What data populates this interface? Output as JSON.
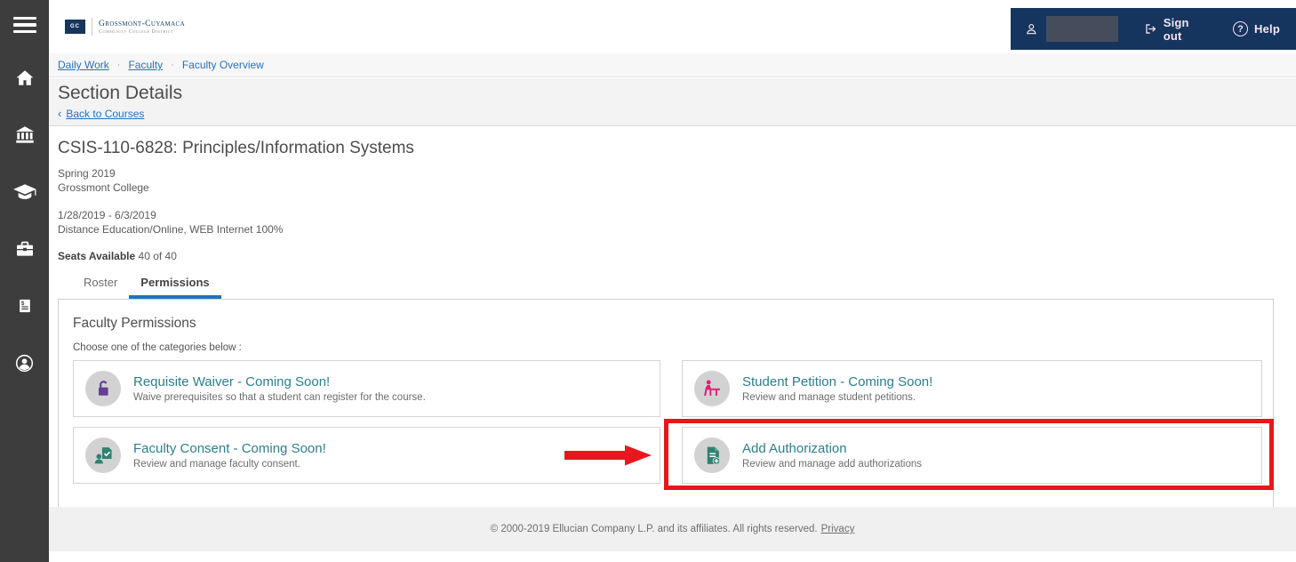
{
  "sidebar": {
    "icons": [
      {
        "name": "menu-icon"
      },
      {
        "name": "home-icon"
      },
      {
        "name": "institution-icon"
      },
      {
        "name": "graduation-cap-icon"
      },
      {
        "name": "briefcase-icon"
      },
      {
        "name": "billing-document-icon"
      },
      {
        "name": "user-circle-icon"
      }
    ]
  },
  "header": {
    "logo": {
      "mark": "GC",
      "line1": "Grossmont-Cuyamaca",
      "line2": "Community College District"
    },
    "account": {
      "sign_out_label": "Sign out",
      "help_label": "Help",
      "help_glyph": "?"
    }
  },
  "breadcrumb": {
    "separator": "·",
    "items": [
      {
        "label": "Daily Work"
      },
      {
        "label": "Faculty"
      },
      {
        "label": "Faculty Overview"
      }
    ]
  },
  "page": {
    "title": "Section Details",
    "back_chevron": "‹",
    "back_label": "Back to Courses"
  },
  "course": {
    "title": "CSIS-110-6828: Principles/Information Systems",
    "term": "Spring 2019",
    "college": "Grossmont College",
    "dates": "1/28/2019 - 6/3/2019",
    "modality": "Distance Education/Online, WEB Internet 100%",
    "seats_label": "Seats Available",
    "seats_value": "40 of 40"
  },
  "tabs": {
    "roster": "Roster",
    "permissions": "Permissions"
  },
  "permissions_panel": {
    "heading": "Faculty Permissions",
    "instruction": "Choose one of the categories below :",
    "cards": [
      {
        "title": "Requisite Waiver - Coming Soon!",
        "description": "Waive prerequisites so that a student can register for the course.",
        "icon": "unlock-icon"
      },
      {
        "title": "Student Petition - Coming Soon!",
        "description": "Review and manage student petitions.",
        "icon": "student-desk-icon"
      },
      {
        "title": "Faculty Consent - Coming Soon!",
        "description": "Review and manage faculty consent.",
        "icon": "consent-document-icon"
      },
      {
        "title": "Add Authorization",
        "description": "Review and manage add authorizations",
        "icon": "add-document-icon"
      }
    ]
  },
  "footer": {
    "copyright": "© 2000-2019 Ellucian Company L.P. and its affiliates. All rights reserved.",
    "privacy_label": "Privacy"
  },
  "colors": {
    "header_navy": "#15355f",
    "accent_blue": "#1d74c0",
    "card_title_teal": "#2e7e8c",
    "annotation_red": "#e8161d",
    "icon_purple": "#663d94",
    "icon_pink": "#e31c79",
    "icon_teal": "#2e8273",
    "sidebar_gray": "#3d3d3d"
  }
}
